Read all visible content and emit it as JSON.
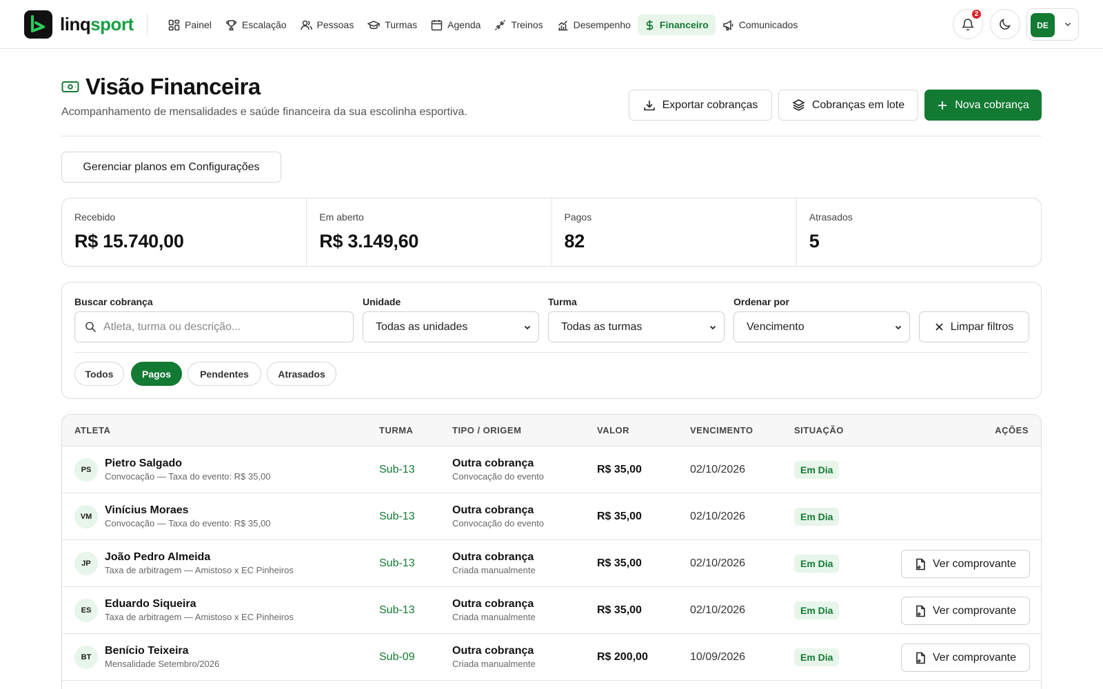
{
  "app": {
    "logo_prefix": "linq",
    "logo_suffix": "sport"
  },
  "nav": {
    "items": [
      {
        "label": "Painel",
        "icon": "grid-icon"
      },
      {
        "label": "Escalação",
        "icon": "trophy-icon"
      },
      {
        "label": "Pessoas",
        "icon": "users-icon"
      },
      {
        "label": "Turmas",
        "icon": "graduation-cap-icon"
      },
      {
        "label": "Agenda",
        "icon": "calendar-icon"
      },
      {
        "label": "Treinos",
        "icon": "dumbbell-icon"
      },
      {
        "label": "Desempenho",
        "icon": "chart-icon"
      },
      {
        "label": "Financeiro",
        "icon": "dollar-icon",
        "active": true
      },
      {
        "label": "Comunicados",
        "icon": "megaphone-icon"
      }
    ],
    "notifications_count": "2",
    "user_initials": "DE"
  },
  "header": {
    "title": "Visão Financeira",
    "subtitle": "Acompanhamento de mensalidades e saúde financeira da sua escolinha esportiva.",
    "export_label": "Exportar cobranças",
    "batch_label": "Cobranças em lote",
    "new_label": "Nova cobrança",
    "manage_plans_label": "Gerenciar planos em Configurações"
  },
  "kpis": [
    {
      "label": "Recebido",
      "value": "R$ 15.740,00"
    },
    {
      "label": "Em aberto",
      "value": "R$ 3.149,60"
    },
    {
      "label": "Pagos",
      "value": "82"
    },
    {
      "label": "Atrasados",
      "value": "5"
    }
  ],
  "filters": {
    "search_label": "Buscar cobrança",
    "search_placeholder": "Atleta, turma ou descrição...",
    "unit_label": "Unidade",
    "unit_value": "Todas as unidades",
    "class_label": "Turma",
    "class_value": "Todas as turmas",
    "order_label": "Ordenar por",
    "order_value": "Vencimento",
    "clear_label": "Limpar filtros",
    "chips": [
      "Todos",
      "Pagos",
      "Pendentes",
      "Atrasados"
    ],
    "active_chip": "Pagos"
  },
  "table": {
    "columns": [
      "ATLETA",
      "TURMA",
      "TIPO / ORIGEM",
      "VALOR",
      "VENCIMENTO",
      "SITUAÇÃO",
      "AÇÕES"
    ],
    "action_label": "Ver comprovante",
    "rows": [
      {
        "initials": "PS",
        "name": "Pietro Salgado",
        "desc": "Convocação — Taxa do evento: R$ 35,00",
        "turma": "Sub-13",
        "tipo": "Outra cobrança",
        "origem": "Convocação do evento",
        "valor": "R$ 35,00",
        "vencimento": "02/10/2026",
        "status": "Em Dia",
        "has_action": false
      },
      {
        "initials": "VM",
        "name": "Vinícius Moraes",
        "desc": "Convocação — Taxa do evento: R$ 35,00",
        "turma": "Sub-13",
        "tipo": "Outra cobrança",
        "origem": "Convocação do evento",
        "valor": "R$ 35,00",
        "vencimento": "02/10/2026",
        "status": "Em Dia",
        "has_action": false
      },
      {
        "initials": "JP",
        "name": "João Pedro Almeida",
        "desc": "Taxa de arbitragem — Amistoso x EC Pinheiros",
        "turma": "Sub-13",
        "tipo": "Outra cobrança",
        "origem": "Criada manualmente",
        "valor": "R$ 35,00",
        "vencimento": "02/10/2026",
        "status": "Em Dia",
        "has_action": true
      },
      {
        "initials": "ES",
        "name": "Eduardo Siqueira",
        "desc": "Taxa de arbitragem — Amistoso x EC Pinheiros",
        "turma": "Sub-13",
        "tipo": "Outra cobrança",
        "origem": "Criada manualmente",
        "valor": "R$ 35,00",
        "vencimento": "02/10/2026",
        "status": "Em Dia",
        "has_action": true
      },
      {
        "initials": "BT",
        "name": "Benício Teixeira",
        "desc": "Mensalidade Setembro/2026",
        "turma": "Sub-09",
        "tipo": "Outra cobrança",
        "origem": "Criada manualmente",
        "valor": "R$ 200,00",
        "vencimento": "10/09/2026",
        "status": "Em Dia",
        "has_action": true
      }
    ]
  },
  "colors": {
    "brand_green": "#137a33",
    "light_green": "#e7f5ea",
    "badge_red": "#d8232a"
  }
}
